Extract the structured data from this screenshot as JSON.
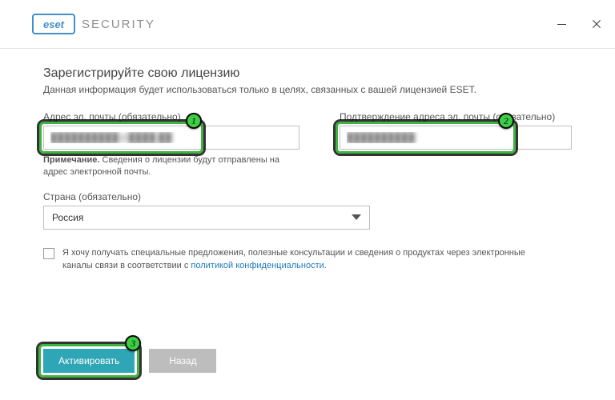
{
  "brand": {
    "logo": "eset",
    "product": "SECURITY"
  },
  "header": {
    "title": "Зарегистрируйте свою лицензию",
    "subtitle": "Данная информация будет использоваться только в целях, связанных с вашей лицензией ESET."
  },
  "fields": {
    "email": {
      "label": "Адрес эл. почты (обязательно)",
      "value": "██████████@████.██"
    },
    "confirm": {
      "label": "Подтверждение адреса эл. почты (обязательно)",
      "value": "██████████"
    },
    "note_bold": "Примечание.",
    "note_rest": " Сведения о лицензии будут отправлены на адрес электронной почты.",
    "country": {
      "label": "Страна (обязательно)",
      "value": "Россия"
    }
  },
  "consent": {
    "text_before": "Я хочу получать специальные предложения, полезные консультации и сведения о продуктах через электронные каналы связи в соответствии с ",
    "link": "политикой конфиденциальности",
    "text_after": "."
  },
  "buttons": {
    "activate": "Активировать",
    "back": "Назад"
  },
  "callouts": {
    "one": "1",
    "two": "2",
    "three": "3"
  }
}
